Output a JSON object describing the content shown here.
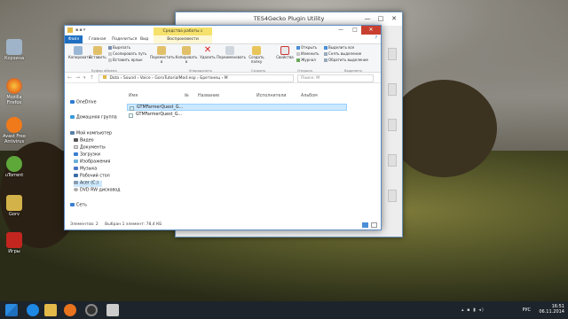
{
  "desktop": {
    "icons": [
      {
        "label": "Корзина",
        "color": "#9fb4c8"
      },
      {
        "label": "Mozilla Firefox",
        "color": "#e8731e"
      },
      {
        "label": "Avast Free Antivirus",
        "color": "#f07a1a"
      },
      {
        "label": "uTorrent",
        "color": "#5ea83a"
      },
      {
        "label": "Gorv",
        "color": "#d4b24a"
      },
      {
        "label": "Игры",
        "color": "#c2261f"
      }
    ]
  },
  "gecko": {
    "title": "TES4Gecko Plugin Utility",
    "minimize": "—",
    "maximize": "□",
    "close": "✕",
    "m_label": "M"
  },
  "explorer": {
    "context_tab": "Средства работы с музыкой",
    "window": {
      "minimize": "—",
      "maximize": "□",
      "close": "✕"
    },
    "tabs": [
      "Файл",
      "Главная",
      "Поделиться",
      "Вид",
      "Воспроизвести"
    ],
    "ribbon": {
      "copy": "Копировать",
      "paste": "Вставить",
      "cut": "Вырезать",
      "copy_path": "Скопировать путь",
      "paste_shortcut": "Вставить ярлык",
      "move_to": "Переместить в",
      "copy_to": "Копировать в",
      "delete": "Удалить",
      "rename": "Переименовать",
      "new_folder": "Создать папку",
      "properties": "Свойства",
      "open": "Открыть",
      "edit": "Изменить",
      "history": "Журнал",
      "select_all": "Выделить все",
      "select_none": "Снять выделение",
      "invert_selection": "Обратить выделение",
      "group_clipboard": "Буфер обмена",
      "group_organize": "Упорядочить",
      "group_new": "Создать",
      "group_open": "Открыть",
      "group_select": "Выделить"
    },
    "path": [
      "Data",
      "Sound",
      "Voice",
      "GorvTutorialMod.esp",
      "Бретонец",
      "M"
    ],
    "search_placeholder": "Поиск: M",
    "nav": [
      "OneDrive",
      "Домашняя группа",
      "Мой компьютер",
      "Видео",
      "Документы",
      "Загрузки",
      "Изображения",
      "Музыка",
      "Рабочий стол",
      "Acer (C:)",
      "DVD RW дисковод",
      "Сеть"
    ],
    "columns": [
      "Имя",
      "№",
      "Название",
      "Исполнители",
      "Альбом"
    ],
    "files": [
      {
        "name": "GTMFarmerQuest_G...",
        "selected": true
      },
      {
        "name": "GTMFarmerQuest_G...",
        "selected": false
      }
    ],
    "status_items": "Элементов: 2",
    "status_selected": "Выбран 1 элемент: 78,4 КБ"
  },
  "taskbar": {
    "lang": "РУС",
    "time": "16:51",
    "date": "06.11.2014"
  }
}
